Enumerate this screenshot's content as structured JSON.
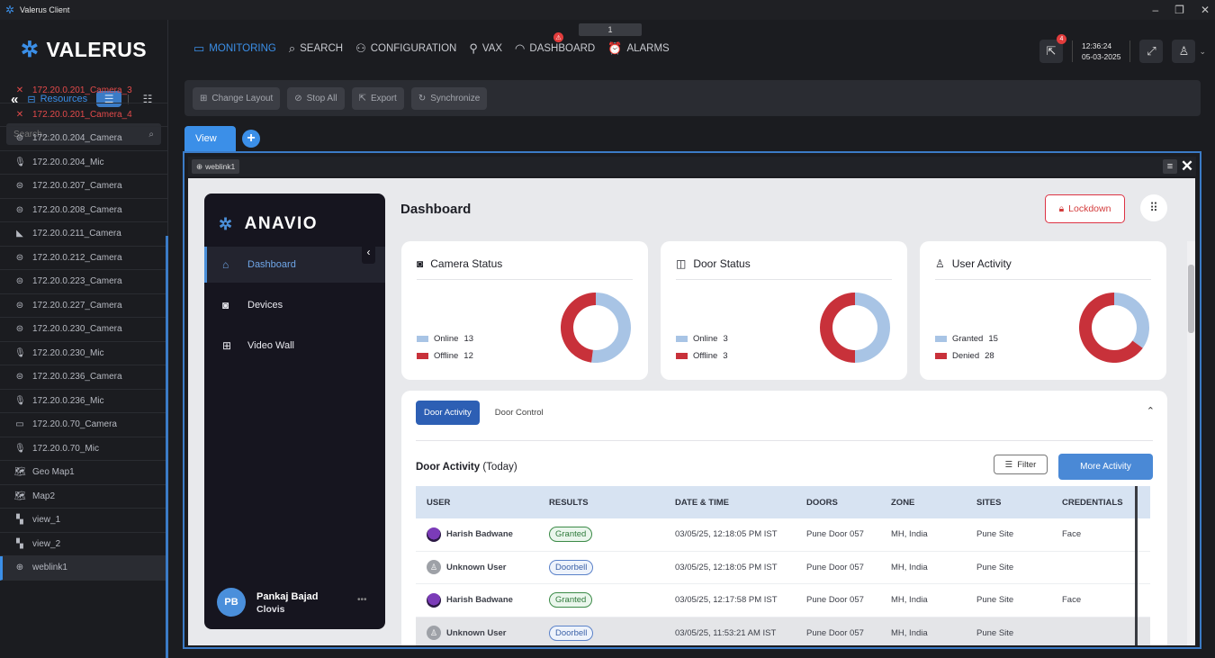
{
  "window": {
    "title": "Valerus Client",
    "controls": [
      "–",
      "❐",
      "✕"
    ]
  },
  "brand": {
    "name": "VALERUS"
  },
  "nav": {
    "items": [
      {
        "label": "MONITORING",
        "icon": "monitor-icon",
        "active": true
      },
      {
        "label": "SEARCH",
        "icon": "search-icon"
      },
      {
        "label": "CONFIGURATION",
        "icon": "configuration-icon"
      },
      {
        "label": "VAX",
        "icon": "vax-icon"
      },
      {
        "label": "DASHBOARD",
        "icon": "dashboard-icon"
      },
      {
        "label": "ALARMS",
        "icon": "alarm-icon"
      }
    ],
    "tab_counter": "1",
    "notif_count": "4",
    "clock_time": "12:36:24",
    "clock_date": "05-03-2025"
  },
  "sidebar": {
    "resources_label": "Resources",
    "search_placeholder": "Search...",
    "items": [
      {
        "label": "172.20.0.201_Camera_3",
        "type": "camera-off",
        "error": true
      },
      {
        "label": "172.20.0.201_Camera_4",
        "type": "camera-off",
        "error": true
      },
      {
        "label": "172.20.0.204_Camera",
        "type": "dome"
      },
      {
        "label": "172.20.0.204_Mic",
        "type": "mic"
      },
      {
        "label": "172.20.0.207_Camera",
        "type": "dome"
      },
      {
        "label": "172.20.0.208_Camera",
        "type": "dome"
      },
      {
        "label": "172.20.0.211_Camera",
        "type": "bullet"
      },
      {
        "label": "172.20.0.212_Camera",
        "type": "dome"
      },
      {
        "label": "172.20.0.223_Camera",
        "type": "dome"
      },
      {
        "label": "172.20.0.227_Camera",
        "type": "dome"
      },
      {
        "label": "172.20.0.230_Camera",
        "type": "dome"
      },
      {
        "label": "172.20.0.230_Mic",
        "type": "mic"
      },
      {
        "label": "172.20.0.236_Camera",
        "type": "dome"
      },
      {
        "label": "172.20.0.236_Mic",
        "type": "mic"
      },
      {
        "label": "172.20.0.70_Camera",
        "type": "box"
      },
      {
        "label": "172.20.0.70_Mic",
        "type": "mic"
      },
      {
        "label": "Geo Map1",
        "type": "map"
      },
      {
        "label": "Map2",
        "type": "map"
      },
      {
        "label": "view_1",
        "type": "view"
      },
      {
        "label": "view_2",
        "type": "view"
      },
      {
        "label": "weblink1",
        "type": "web",
        "selected": true
      }
    ]
  },
  "toolbar": {
    "change_layout": "Change Layout",
    "stop_all": "Stop All",
    "export": "Export",
    "synchronize": "Synchronize"
  },
  "view": {
    "tab_label": "View",
    "weblink_label": "weblink1"
  },
  "anavio": {
    "brand": "ANAVIO",
    "menu": [
      {
        "label": "Dashboard",
        "icon": "home-icon"
      },
      {
        "label": "Devices",
        "icon": "camera-icon"
      },
      {
        "label": "Video Wall",
        "icon": "grid-icon"
      }
    ],
    "user": {
      "initials": "PB",
      "name": "Pankaj Bajad",
      "org": "Clovis"
    },
    "page_title": "Dashboard",
    "lockdown": "Lockdown",
    "cards": [
      {
        "title": "Camera Status",
        "icon": "camera-icon",
        "legend": [
          {
            "label": "Online",
            "value": 13,
            "color": "#a8c4e5"
          },
          {
            "label": "Offline",
            "value": 12,
            "color": "#c8313a"
          }
        ]
      },
      {
        "title": "Door Status",
        "icon": "door-icon",
        "legend": [
          {
            "label": "Online",
            "value": 3,
            "color": "#a8c4e5"
          },
          {
            "label": "Offline",
            "value": 3,
            "color": "#c8313a"
          }
        ]
      },
      {
        "title": "User Activity",
        "icon": "user-icon",
        "legend": [
          {
            "label": "Granted",
            "value": 15,
            "color": "#a8c4e5"
          },
          {
            "label": "Denied",
            "value": 28,
            "color": "#c8313a"
          }
        ]
      }
    ],
    "activity": {
      "tab_active": "Door Activity",
      "tab_other": "Door Control",
      "title": "Door Activity",
      "title_suffix": "(Today)",
      "filter": "Filter",
      "more": "More Activity",
      "columns": [
        "USER",
        "RESULTS",
        "DATE & TIME",
        "DOORS",
        "ZONE",
        "SITES",
        "CREDENTIALS"
      ],
      "rows": [
        {
          "user": "Harish Badwane",
          "result": "Granted",
          "datetime": "03/05/25, 12:18:05 PM IST",
          "door": "Pune Door 057",
          "zone": "MH, India",
          "site": "Pune Site",
          "cred": "Face"
        },
        {
          "user": "Unknown User",
          "result": "Doorbell",
          "datetime": "03/05/25, 12:18:05 PM IST",
          "door": "Pune Door 057",
          "zone": "MH, India",
          "site": "Pune Site",
          "cred": ""
        },
        {
          "user": "Harish Badwane",
          "result": "Granted",
          "datetime": "03/05/25, 12:17:58 PM IST",
          "door": "Pune Door 057",
          "zone": "MH, India",
          "site": "Pune Site",
          "cred": "Face"
        },
        {
          "user": "Unknown User",
          "result": "Doorbell",
          "datetime": "03/05/25, 11:53:21 AM IST",
          "door": "Pune Door 057",
          "zone": "MH, India",
          "site": "Pune Site",
          "cred": ""
        }
      ]
    }
  }
}
